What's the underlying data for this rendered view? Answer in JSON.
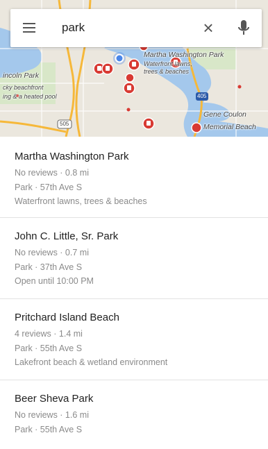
{
  "search": {
    "query": "park"
  },
  "map": {
    "labels": [
      {
        "text": "Martha Washington Park",
        "id": "martha"
      },
      {
        "text": "Waterfront lawns,",
        "id": "wf1"
      },
      {
        "text": "trees & beaches",
        "id": "wf2"
      },
      {
        "text": "incoln Park",
        "id": "lincoln"
      },
      {
        "text": "cky beachfront",
        "id": "rocky"
      },
      {
        "text": "ing & a heated pool",
        "id": "pool"
      },
      {
        "text": "Gene Coulon",
        "id": "gene"
      },
      {
        "text": "Memorial Beach",
        "id": "memorial"
      },
      {
        "text": "505",
        "id": "r505"
      },
      {
        "text": "405",
        "id": "r405"
      }
    ]
  },
  "results": [
    {
      "name": "Martha Washington Park",
      "reviews": "No reviews · 0.8 mi",
      "type": "Park · 57th Ave S",
      "detail": "Waterfront lawns, trees & beaches"
    },
    {
      "name": "John C. Little, Sr. Park",
      "reviews": "No reviews · 0.7 mi",
      "type": "Park · 37th Ave S",
      "detail": "Open until 10:00 PM"
    },
    {
      "name": "Pritchard Island Beach",
      "reviews": "4 reviews · 1.4 mi",
      "type": "Park · 55th Ave S",
      "detail": "Lakefront beach & wetland environment"
    },
    {
      "name": "Beer Sheva Park",
      "reviews": "No reviews · 1.6 mi",
      "type": "Park · 55th Ave S",
      "detail": ""
    }
  ],
  "colors": {
    "water": "#a4c8ec",
    "road": "#f6b83a",
    "marker": "#d83a33",
    "location": "#4a86e8"
  }
}
